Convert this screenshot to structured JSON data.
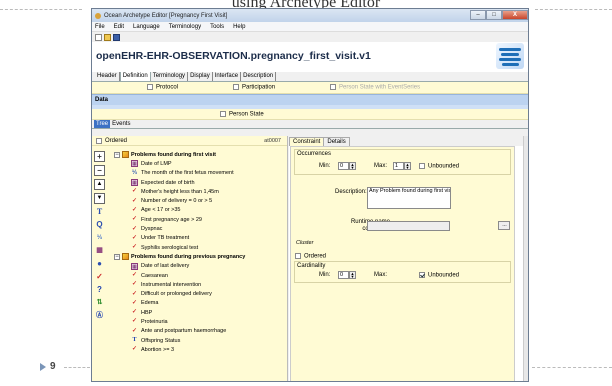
{
  "slide": {
    "title": "using Archetype Editor",
    "page_number": "9"
  },
  "window": {
    "title": "Ocean Archetype Editor [Pregnancy First Visit]",
    "buttons": {
      "minimize": "–",
      "maximize": "□",
      "close": "X"
    }
  },
  "menu": [
    "File",
    "Edit",
    "Language",
    "Terminology",
    "Tools",
    "Help"
  ],
  "archetype_id": "openEHR-EHR-OBSERVATION.pregnancy_first_visit.v1",
  "main_tabs": [
    "Header",
    "Definition",
    "Terminology",
    "Display",
    "Interface",
    "Description"
  ],
  "active_main_tab": "Definition",
  "structure": {
    "protocol": "Protocol",
    "participation": "Participation",
    "state_events": "Person State with EventSeries",
    "data": "Data",
    "person_state": "Person State"
  },
  "tree_tabs": [
    "Tree",
    "Events"
  ],
  "ordered_label": "Ordered",
  "at_code": "at0007",
  "tree": [
    {
      "level": 0,
      "icon": "cluster",
      "label": "Problems found during first visit",
      "expander": "−"
    },
    {
      "level": 1,
      "icon": "date",
      "label": "Date of LMP"
    },
    {
      "level": 1,
      "icon": "duration",
      "label": "The month of the first fetus movement"
    },
    {
      "level": 1,
      "icon": "date",
      "label": "Expected date of birth"
    },
    {
      "level": 1,
      "icon": "check",
      "label": "Mother's height less than 1,45m"
    },
    {
      "level": 1,
      "icon": "check",
      "label": "Number of delivery = 0 or > 5"
    },
    {
      "level": 1,
      "icon": "check",
      "label": "Age < 17 or >35"
    },
    {
      "level": 1,
      "icon": "check",
      "label": "First pregnancy age > 29"
    },
    {
      "level": 1,
      "icon": "check",
      "label": "Dyspnac"
    },
    {
      "level": 1,
      "icon": "check",
      "label": "Under TB treatment"
    },
    {
      "level": 1,
      "icon": "check",
      "label": "Syphilis serological test"
    },
    {
      "level": 0,
      "icon": "cluster",
      "label": "Problems found during previous pregnancy",
      "expander": "−"
    },
    {
      "level": 1,
      "icon": "date",
      "label": "Date of last delivery"
    },
    {
      "level": 1,
      "icon": "check",
      "label": "Caesarean"
    },
    {
      "level": 1,
      "icon": "check",
      "label": "Instrumental intervention"
    },
    {
      "level": 1,
      "icon": "check",
      "label": "Difficult or prolonged delivery"
    },
    {
      "level": 1,
      "icon": "check",
      "label": "Edema"
    },
    {
      "level": 1,
      "icon": "check",
      "label": "HBP"
    },
    {
      "level": 1,
      "icon": "check",
      "label": "Proteinuria"
    },
    {
      "level": 1,
      "icon": "check",
      "label": "Ante and postpartum haemorrhage"
    },
    {
      "level": 1,
      "icon": "text",
      "label": "Offspring Status"
    },
    {
      "level": 1,
      "icon": "check",
      "label": "Abortion >= 3"
    }
  ],
  "side_tools": [
    "add",
    "remove",
    "move-up",
    "move-down",
    "text",
    "quantity",
    "count",
    "date",
    "ordinal",
    "boolean",
    "any",
    "interval",
    "link",
    "slot"
  ],
  "detail_tabs": [
    "Constraint",
    "Details"
  ],
  "constraint": {
    "occurrences": "Occurrences",
    "min_label": "Min:",
    "min_value": "0",
    "max_label": "Max:",
    "max_value": "1",
    "unbounded": "Unbounded",
    "description_label": "Description:",
    "description_value": "Any Problem found during first visit",
    "runtime_label_line1": "Runtime name",
    "runtime_label_line2": "constraint:",
    "runtime_button": "...",
    "cluster_label": "Cluster",
    "ordered": "Ordered",
    "cardinality": "Cardinality",
    "card_min_label": "Min:",
    "card_min_value": "0",
    "card_max_label": "Max:",
    "card_unbounded": "Unbounded"
  }
}
